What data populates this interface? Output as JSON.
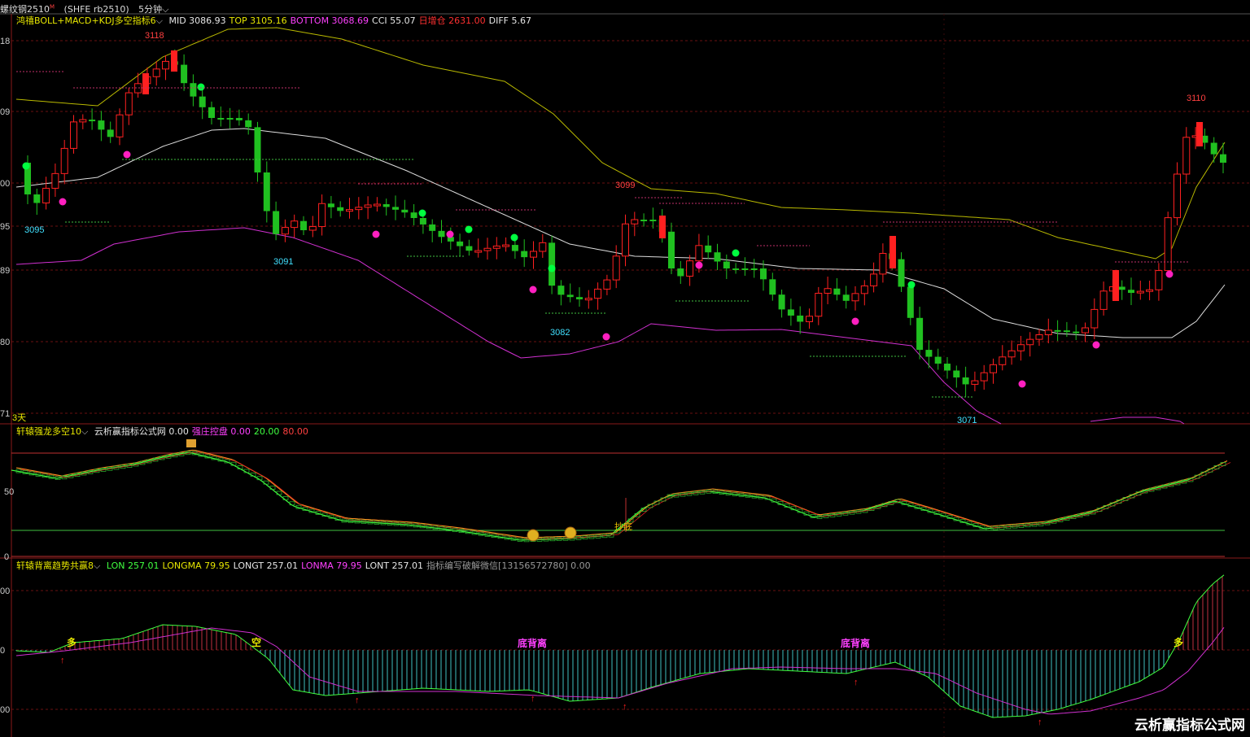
{
  "toolbar": {
    "symbol": "螺纹钢2510",
    "symbol_sup": "M",
    "code": "(SHFE rb2510)",
    "period": "5分钟"
  },
  "panel1": {
    "title": "鸿禧BOLL+MACD+KDJ多空指标6",
    "items": [
      {
        "t": "MID 3086.93",
        "c": "#e6e6e6"
      },
      {
        "t": "TOP 3105.16",
        "c": "#e6e600"
      },
      {
        "t": "BOTTOM 3068.69",
        "c": "#ff40ff"
      },
      {
        "t": "CCI 55.07",
        "c": "#e6e6e6"
      },
      {
        "t": "日增仓 2631.00",
        "c": "#ff3030"
      },
      {
        "t": "DIFF 5.67",
        "c": "#e6e6e6"
      }
    ],
    "y_labels": [
      "18",
      "09",
      "00",
      "95",
      "89",
      "80",
      "71"
    ],
    "price_marks": [
      {
        "t": "3118",
        "c": "#ff4040"
      },
      {
        "t": "3095",
        "c": "#40e0ff"
      },
      {
        "t": "3091",
        "c": "#40e0ff"
      },
      {
        "t": "3082",
        "c": "#40e0ff"
      },
      {
        "t": "3099",
        "c": "#ff4040"
      },
      {
        "t": "3071",
        "c": "#40e0ff"
      },
      {
        "t": "3110",
        "c": "#ff4040"
      }
    ],
    "day_label": "3天"
  },
  "panel2": {
    "title": "轩辕强龙多空10",
    "items": [
      {
        "t": "云析赢指标公式网 0.00",
        "c": "#e6e6e6"
      },
      {
        "t": "强庄控盘 0.00",
        "c": "#ff40ff"
      },
      {
        "t": "20.00",
        "c": "#40ff40"
      },
      {
        "t": "80.00",
        "c": "#ff4040"
      }
    ],
    "y_labels": [
      "50",
      "0"
    ],
    "bottom_label": "抄底"
  },
  "panel3": {
    "title": "轩辕背离趋势共赢8",
    "items": [
      {
        "t": "LON 257.01",
        "c": "#40ff40"
      },
      {
        "t": "LONGMA 79.95",
        "c": "#e6e600"
      },
      {
        "t": "LONGT 257.01",
        "c": "#e6e6e6"
      },
      {
        "t": "LONMA 79.95",
        "c": "#ff40ff"
      },
      {
        "t": "LONT 257.01",
        "c": "#e6e6e6"
      },
      {
        "t": "指标编写破解微信[13156572780] 0.00",
        "c": "#999999"
      }
    ],
    "y_labels": [
      "00",
      "0",
      "00"
    ],
    "annotations": [
      {
        "t": "多",
        "c": "#e6e600"
      },
      {
        "t": "空",
        "c": "#e6e600"
      },
      {
        "t": "底背离",
        "c": "#ff40ff"
      },
      {
        "t": "底背离",
        "c": "#ff40ff"
      },
      {
        "t": "多",
        "c": "#e6e600"
      }
    ]
  },
  "watermark": "云析赢指标公式网"
}
